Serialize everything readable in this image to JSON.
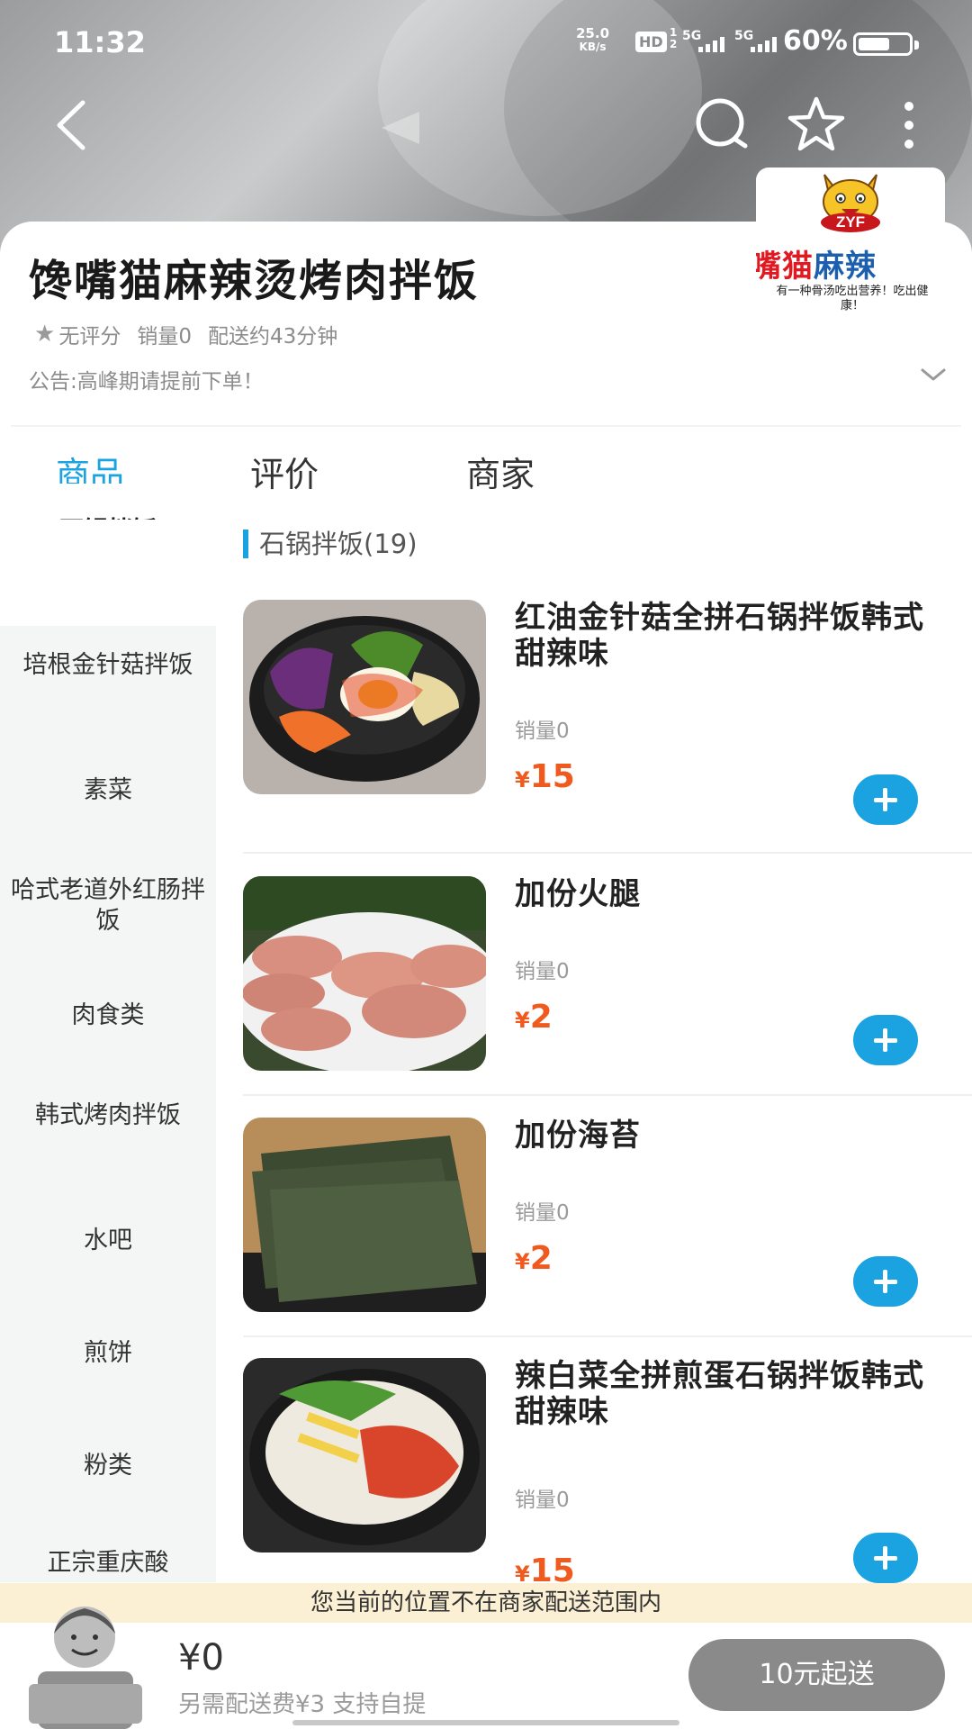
{
  "status_bar": {
    "time": "11:32",
    "net_speed_value": "25.0",
    "net_speed_unit": "KB/s",
    "hd_label": "HD",
    "hd_index": "1",
    "hd_sub": "2",
    "signal1_label": "5G",
    "signal2_label": "5G",
    "battery_percent": "60%"
  },
  "nav": {
    "back_icon": "chevron-left-icon",
    "search_icon": "search-icon",
    "favorite_icon": "star-icon",
    "more_icon": "more-vertical-icon"
  },
  "logo": {
    "badge": "ZYF",
    "brand_part1": "嘴猫",
    "brand_part2": "麻辣",
    "slogan": "有一种骨汤吃出营养！吃出健康！"
  },
  "shop": {
    "title": "馋嘴猫麻辣烫烤肉拌饭",
    "rating": "无评分",
    "sales": "销量0",
    "delivery_time": "配送约43分钟",
    "notice": "公告:高峰期请提前下单！"
  },
  "tabs": [
    {
      "label": "商品"
    },
    {
      "label": "评价"
    },
    {
      "label": "商家"
    }
  ],
  "categories": [
    {
      "label": "石锅拌饭"
    },
    {
      "label": "培根金针菇拌饭"
    },
    {
      "label": "素菜"
    },
    {
      "label": "哈式老道外红肠拌饭"
    },
    {
      "label": "肉食类"
    },
    {
      "label": "韩式烤肉拌饭"
    },
    {
      "label": "水吧"
    },
    {
      "label": "煎饼"
    },
    {
      "label": "粉类"
    },
    {
      "label": "正宗重庆酸"
    }
  ],
  "section": {
    "title": "石锅拌饭(19)"
  },
  "products": [
    {
      "name": "红油金针菇全拼石锅拌饭韩式甜辣味",
      "sales": "销量0",
      "currency": "¥",
      "price": "15"
    },
    {
      "name": "加份火腿",
      "sales": "销量0",
      "currency": "¥",
      "price": "2"
    },
    {
      "name": "加份海苔",
      "sales": "销量0",
      "currency": "¥",
      "price": "2"
    },
    {
      "name": "辣白菜全拼煎蛋石锅拌饭韩式甜辣味",
      "sales": "销量0",
      "currency": "¥",
      "price": "15"
    }
  ],
  "cart": {
    "range_notice": "您当前的位置不在商家配送范围内",
    "total": "¥0",
    "delivery_note": "另需配送费¥3  支持自提",
    "min_order_button": "10元起送"
  },
  "colors": {
    "accent": "#1aa3e0",
    "price": "#f05a1e",
    "notice_bg": "#fcf0d4",
    "disabled_button": "#8a8a8a"
  }
}
